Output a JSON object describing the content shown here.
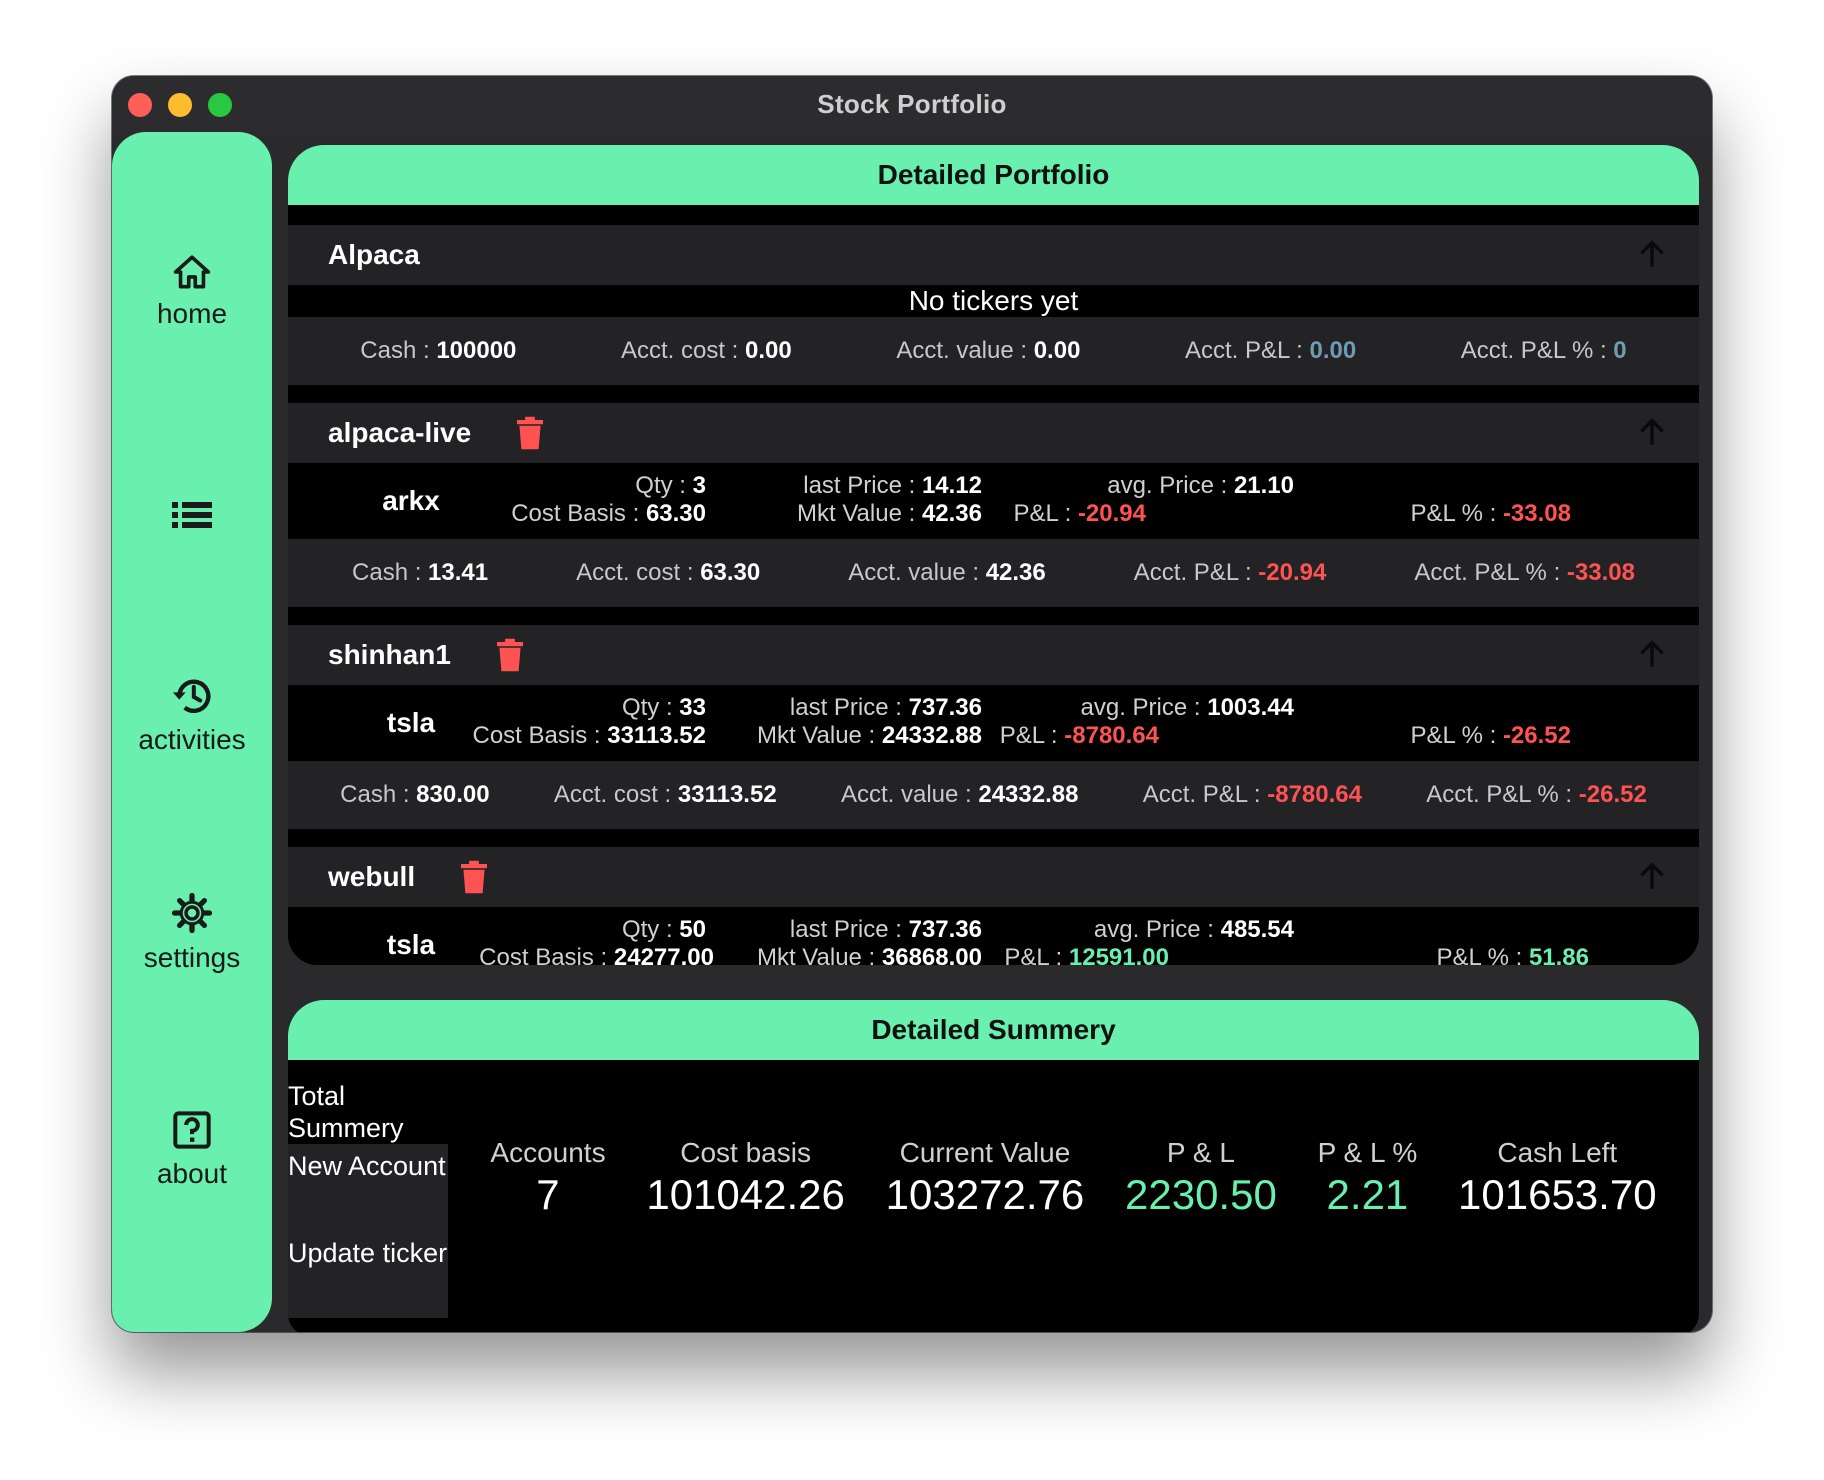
{
  "window": {
    "title": "Stock Portfolio"
  },
  "sidebar": {
    "items": [
      {
        "label": "home",
        "icon": "home-icon"
      },
      {
        "label": "",
        "icon": "list-icon"
      },
      {
        "label": "activities",
        "icon": "history-icon"
      },
      {
        "label": "settings",
        "icon": "gear-icon"
      },
      {
        "label": "about",
        "icon": "help-box-icon"
      }
    ]
  },
  "portfolio": {
    "title": "Detailed Portfolio",
    "accounts": [
      {
        "name": "Alpaca",
        "deletable": false,
        "empty_text": "No tickers yet",
        "totals": {
          "cash_label": "Cash : ",
          "cash": "100000",
          "cost_label": "Acct. cost : ",
          "cost": "0.00",
          "value_label": "Acct. value : ",
          "value": "0.00",
          "pl_label": "Acct. P&L : ",
          "pl": "0.00",
          "plpct_label": "Acct. P&L % : ",
          "plpct": "0"
        }
      },
      {
        "name": "alpaca-live",
        "deletable": true,
        "ticker": {
          "symbol": "arkx",
          "qty_label": "Qty : ",
          "qty": "3",
          "cost_label": "Cost Basis : ",
          "cost": "63.30",
          "last_label": "last Price : ",
          "last": "14.12",
          "mkt_label": "Mkt Value : ",
          "mkt": "42.36",
          "avg_label": "avg. Price : ",
          "avg": "21.10",
          "pl_label": "P&L : ",
          "pl": "-20.94",
          "plpct_label": "P&L % : ",
          "plpct": "-33.08"
        },
        "totals": {
          "cash_label": "Cash : ",
          "cash": "13.41",
          "cost_label": "Acct. cost : ",
          "cost": "63.30",
          "value_label": "Acct. value : ",
          "value": "42.36",
          "pl_label": "Acct. P&L : ",
          "pl": "-20.94",
          "plpct_label": "Acct. P&L % : ",
          "plpct": "-33.08"
        }
      },
      {
        "name": "shinhan1",
        "deletable": true,
        "ticker": {
          "symbol": "tsla",
          "qty_label": "Qty : ",
          "qty": "33",
          "cost_label": "Cost Basis : ",
          "cost": "33113.52",
          "last_label": "last Price : ",
          "last": "737.36",
          "mkt_label": "Mkt Value : ",
          "mkt": "24332.88",
          "avg_label": "avg. Price : ",
          "avg": "1003.44",
          "pl_label": "P&L : ",
          "pl": "-8780.64",
          "plpct_label": "P&L % : ",
          "plpct": "-26.52"
        },
        "totals": {
          "cash_label": "Cash : ",
          "cash": "830.00",
          "cost_label": "Acct. cost : ",
          "cost": "33113.52",
          "value_label": "Acct. value : ",
          "value": "24332.88",
          "pl_label": "Acct. P&L : ",
          "pl": "-8780.64",
          "plpct_label": "Acct. P&L % : ",
          "plpct": "-26.52"
        }
      },
      {
        "name": "webull",
        "deletable": true,
        "ticker": {
          "symbol": "tsla",
          "qty_label": "Qty : ",
          "qty": "50",
          "cost_label": "Cost Basis : ",
          "cost": "24277.00",
          "last_label": "last Price : ",
          "last": "737.36",
          "mkt_label": "Mkt Value : ",
          "mkt": "36868.00",
          "avg_label": "avg. Price : ",
          "avg": "485.54",
          "pl_label": "P&L : ",
          "pl": "12591.00",
          "plpct_label": "P&L % : ",
          "plpct": "51.86"
        }
      }
    ]
  },
  "summary": {
    "title": "Detailed Summery",
    "menu": [
      "Total Summery",
      "New Account",
      "Update ticker"
    ],
    "stats": [
      {
        "label": "Accounts",
        "value": "7"
      },
      {
        "label": "Cost basis",
        "value": "101042.26"
      },
      {
        "label": "Current Value",
        "value": "103272.76"
      },
      {
        "label": "P & L",
        "value": "2230.50"
      },
      {
        "label": "P & L %",
        "value": "2.21"
      },
      {
        "label": "Cash Left",
        "value": "101653.70"
      }
    ]
  },
  "colors": {
    "accent": "#69f0ae",
    "negative": "#ff5252",
    "neutral": "#6f9bb3",
    "panel": "#232325",
    "background": "#000000"
  }
}
